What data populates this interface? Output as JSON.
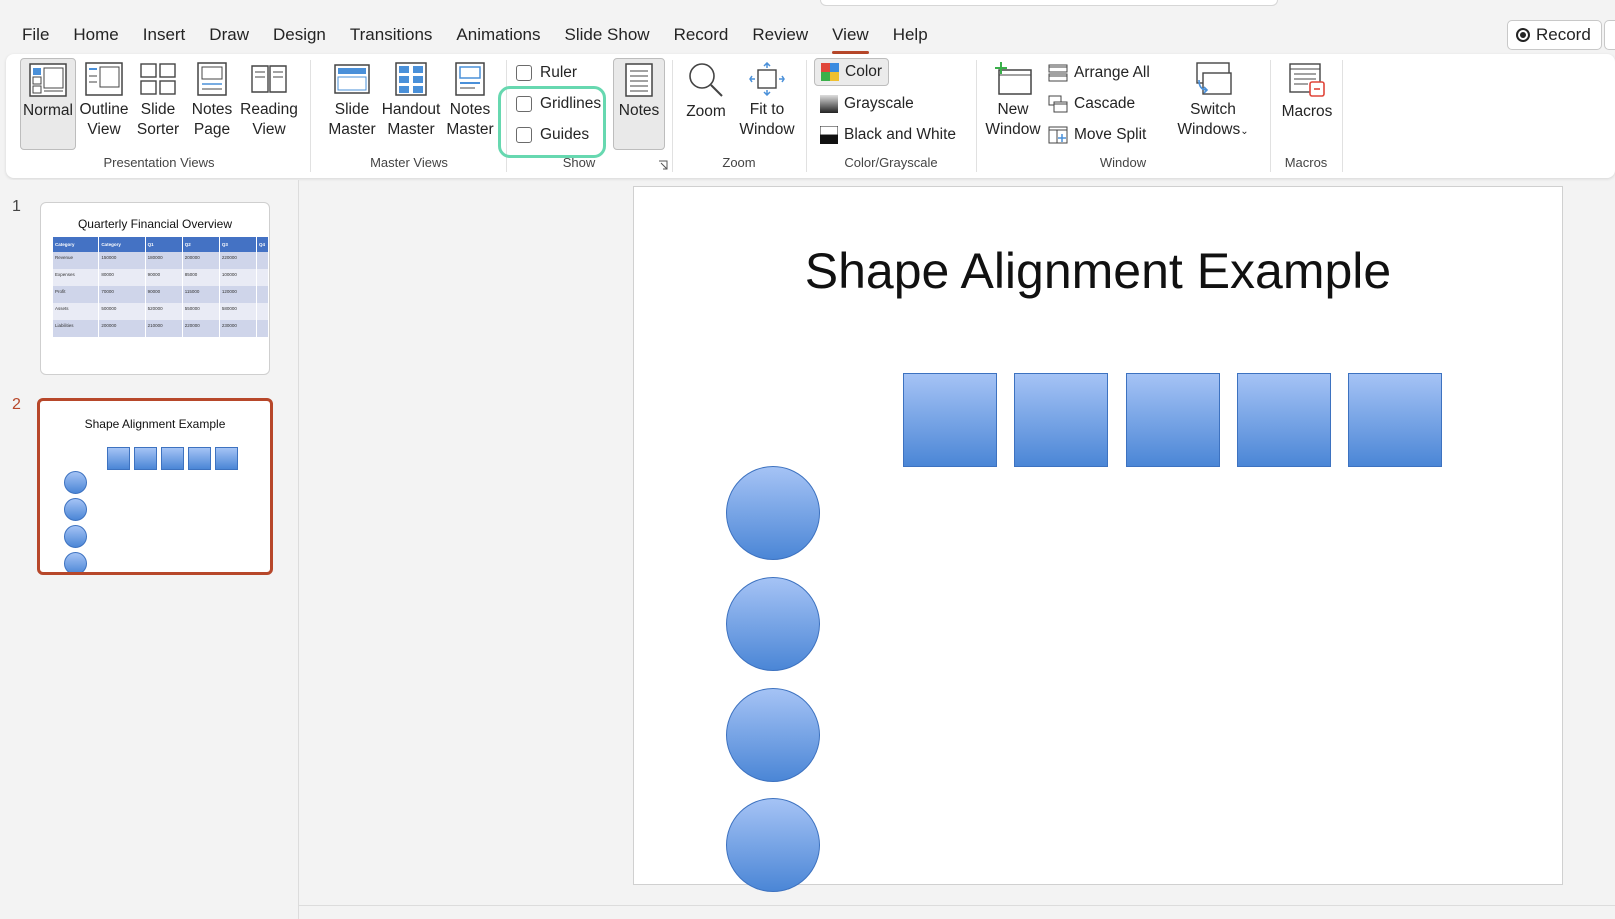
{
  "menu": [
    "File",
    "Home",
    "Insert",
    "Draw",
    "Design",
    "Transitions",
    "Animations",
    "Slide Show",
    "Record",
    "Review",
    "View",
    "Help"
  ],
  "active_tab": "View",
  "record_button": "Record",
  "ribbon": {
    "presentation_views": {
      "label": "Presentation Views",
      "normal": "Normal",
      "outline": [
        "Outline",
        "View"
      ],
      "sorter": [
        "Slide",
        "Sorter"
      ],
      "notes_page": [
        "Notes",
        "Page"
      ],
      "reading": [
        "Reading",
        "View"
      ]
    },
    "master_views": {
      "label": "Master Views",
      "slide_master": [
        "Slide",
        "Master"
      ],
      "handout_master": [
        "Handout",
        "Master"
      ],
      "notes_master": [
        "Notes",
        "Master"
      ]
    },
    "show": {
      "label": "Show",
      "ruler": "Ruler",
      "gridlines": "Gridlines",
      "guides": "Guides",
      "notes": "Notes"
    },
    "zoom": {
      "label": "Zoom",
      "zoom": "Zoom",
      "fit": [
        "Fit to",
        "Window"
      ]
    },
    "color": {
      "label": "Color/Grayscale",
      "color": "Color",
      "grayscale": "Grayscale",
      "bw": "Black and White"
    },
    "window": {
      "label": "Window",
      "new": [
        "New",
        "Window"
      ],
      "arrange": "Arrange All",
      "cascade": "Cascade",
      "move_split": "Move Split",
      "switch": [
        "Switch",
        "Windows"
      ]
    },
    "macros": {
      "label": "Macros",
      "macros": "Macros"
    }
  },
  "thumbnails": [
    {
      "number": "1",
      "title": "Quarterly Financial Overview",
      "table": {
        "headers": [
          "Category",
          "Category",
          "Q1",
          "Q2",
          "Q3",
          "Q4"
        ],
        "rows": [
          [
            "Revenue",
            "150000",
            "180000",
            "200000",
            "220000",
            ""
          ],
          [
            "Expenses",
            "80000",
            "90000",
            "85000",
            "100000",
            ""
          ],
          [
            "Profit",
            "70000",
            "90000",
            "115000",
            "120000",
            ""
          ],
          [
            "Assets",
            "500000",
            "520000",
            "550000",
            "580000",
            ""
          ],
          [
            "Liabilities",
            "200000",
            "210000",
            "220000",
            "230000",
            ""
          ]
        ]
      }
    },
    {
      "number": "2",
      "title": "Shape Alignment Example"
    }
  ],
  "slide": {
    "title": "Shape Alignment Example",
    "square_count": 5,
    "circle_count": 4
  },
  "colors": {
    "accent": "#b7472a",
    "highlight": "#67d8b0",
    "shape_top": "#a5c3f5",
    "shape_bottom": "#4b86d6"
  }
}
